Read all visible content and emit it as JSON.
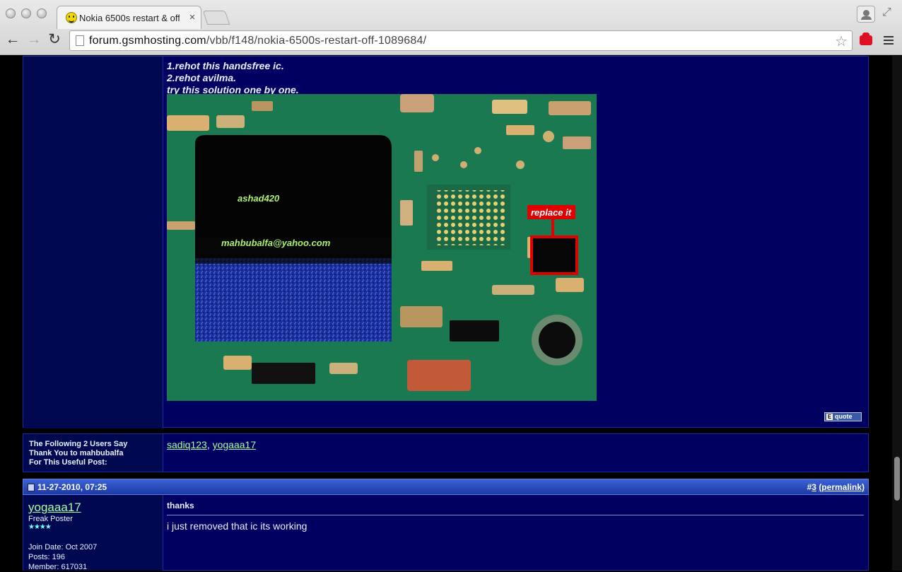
{
  "browser": {
    "tab_title": "Nokia 6500s restart & off",
    "tab_close": "×",
    "url_host": "forum.gsmhosting.com",
    "url_path": "/vbb/f148/nokia-6500s-restart-off-1089684/",
    "nav": {
      "back": "←",
      "forward": "→",
      "reload": "↻"
    },
    "star": "☆",
    "fullscreen": "⤢"
  },
  "post1": {
    "lines": [
      "1.rehot this handsfree ic.",
      "2.rehot avilma.",
      "try this solution one by one."
    ],
    "image": {
      "watermark1": "ashad420",
      "watermark2": "mahbubalfa@yahoo.com",
      "callout": "replace it"
    },
    "quote_label": "quote"
  },
  "thanks": {
    "label_lines": [
      "The Following 2 Users Say",
      "Thank You to mahbubalfa",
      "For This Useful Post:"
    ],
    "users": [
      "sadiq123",
      "yogaaa17"
    ],
    "separator": ","
  },
  "post3": {
    "date": "11-27-2010, 07:25",
    "post_prefix": "#",
    "post_number": "3",
    "permalink": "(permalink)",
    "username": "yogaaa17",
    "rank": "Freak Poster",
    "stars": "★★★★",
    "join_date": "Join Date: Oct 2007",
    "posts": "Posts: 196",
    "member": "Member: 617031",
    "title": "thanks",
    "body": "i just removed that ic its working"
  },
  "colors": {
    "page_bg": "#000060",
    "link": "#a9ffa0",
    "header_bar": "#2a4cc0",
    "callout": "#e00000"
  }
}
